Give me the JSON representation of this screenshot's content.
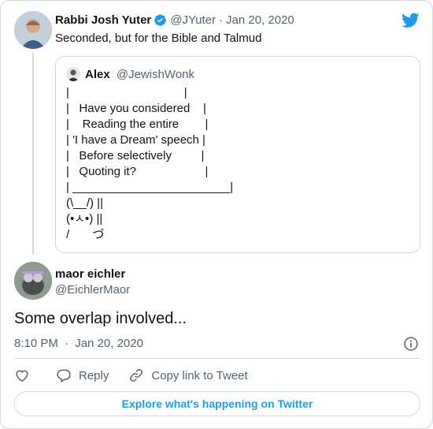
{
  "colors": {
    "accent": "#1d9bf0",
    "text": "#0f1419",
    "muted": "#536471",
    "border": "#cfd9de"
  },
  "parent_tweet": {
    "avatar_icon": "profile-photo",
    "author_name": "Rabbi Josh Yuter",
    "verified_icon": "verified-badge-icon",
    "handle": "@JYuter",
    "separator": "·",
    "date": "Jan 20, 2020",
    "text": "Seconded, but for the Bible and Talmud",
    "brand_icon": "twitter-bird-icon"
  },
  "quoted_tweet": {
    "avatar_icon": "profile-photo",
    "author_name": "Alex",
    "handle": "@JewishWonk",
    "lines": [
      "|                                   |",
      "|   Have you considered    |",
      "|    Reading the entire        |",
      "| 'I have a Dream' speech |",
      "|   Before selectively         |",
      "|   Quoting it?                     |",
      "| ________________________|",
      "(\\__/) ||",
      "(•ㅅ•) ||",
      "/       づ"
    ]
  },
  "reply_tweet": {
    "avatar_icon": "profile-photo",
    "author_name": "maor eichler",
    "handle": "@EichlerMaor",
    "text": "Some overlap involved...",
    "time": "8:10 PM",
    "separator": "·",
    "date": "Jan 20, 2020",
    "info_icon": "info-icon"
  },
  "actions": {
    "like_icon": "heart-icon",
    "reply_icon": "reply-bubble-icon",
    "reply_label": "Reply",
    "copy_icon": "link-icon",
    "copy_label": "Copy link to Tweet"
  },
  "footer": {
    "explore_label": "Explore what's happening on Twitter"
  }
}
